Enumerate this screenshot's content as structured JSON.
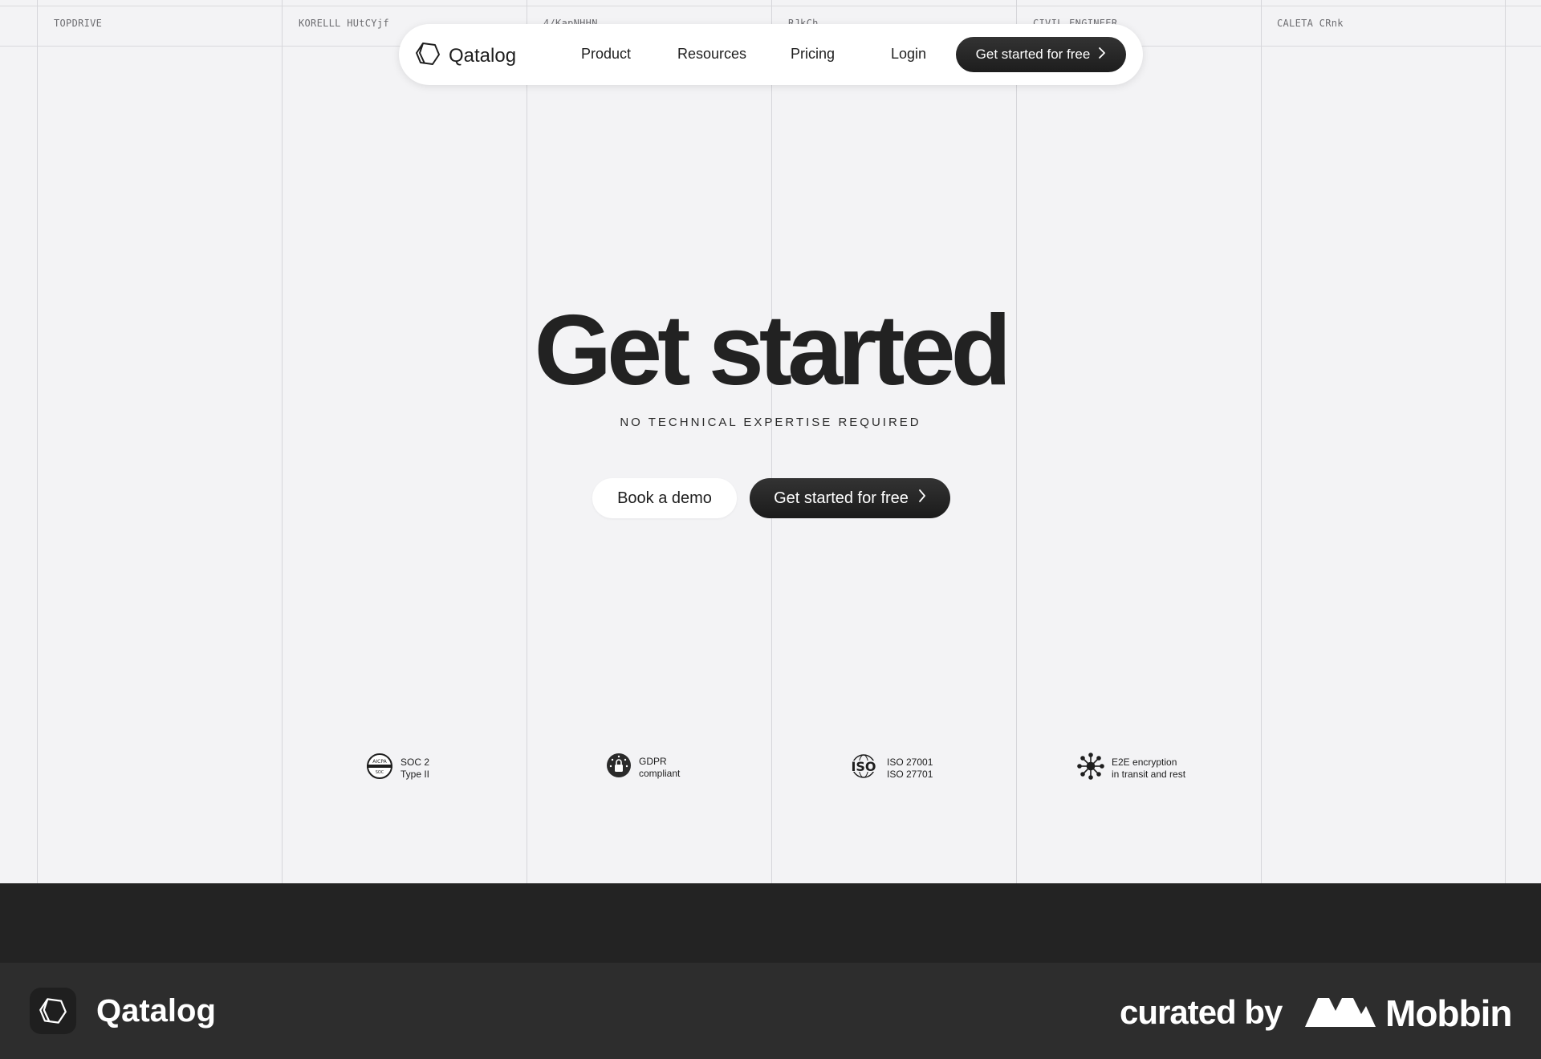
{
  "grid": {
    "column_labels": [
      "TOPDRIVE",
      "KORELLL HUtCYjf",
      "4/KapNHHN",
      "RJkCh",
      "CIVIL ENGINEER",
      "CALETA CRnk"
    ]
  },
  "nav": {
    "brand": "Qatalog",
    "links": [
      "Product",
      "Resources",
      "Pricing",
      "Login"
    ],
    "cta_label": "Get started for free"
  },
  "hero": {
    "title": "Get started",
    "subtitle": "NO TECHNICAL EXPERTISE REQUIRED",
    "secondary_button": "Book a demo",
    "primary_button": "Get started for free"
  },
  "badges": [
    {
      "icon": "soc2-icon",
      "line1": "SOC 2",
      "line2": "Type II"
    },
    {
      "icon": "gdpr-icon",
      "line1": "GDPR",
      "line2": "compliant"
    },
    {
      "icon": "iso-icon",
      "line1": "ISO 27001",
      "line2": "ISO 27701"
    },
    {
      "icon": "encryption-icon",
      "line1": "E2E encryption",
      "line2": "in transit and rest"
    }
  ],
  "footer": {
    "brand": "Qatalog",
    "curated_by": "curated by",
    "curator": "Mobbin"
  },
  "colors": {
    "page_bg": "#f3f3f5",
    "dark": "#1e1e1e",
    "footer_bg": "#2d2d2d"
  }
}
